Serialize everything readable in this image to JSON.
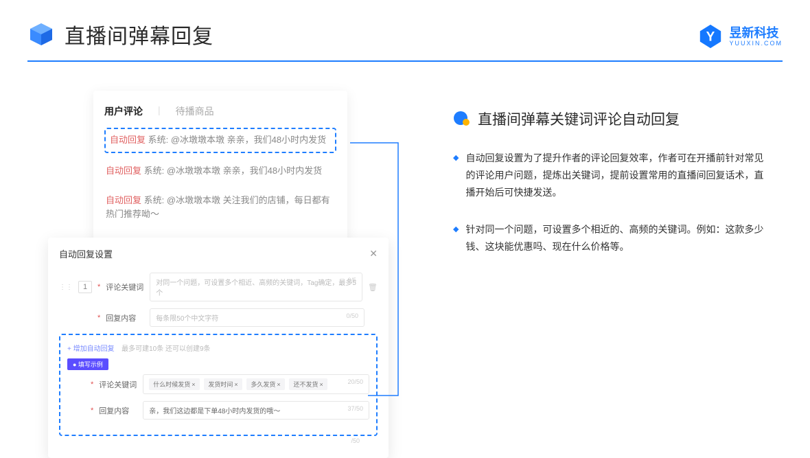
{
  "header": {
    "title": "直播间弹幕回复"
  },
  "brand": {
    "name": "昱新科技",
    "url": "YUUXIN.COM"
  },
  "comments": {
    "tab_active": "用户评论",
    "tab_inactive": "待播商品",
    "auto_tag": "自动回复",
    "row1": "系统: @冰墩墩本墩 亲亲，我们48小时内发货",
    "row2": "系统: @冰墩墩本墩 亲亲，我们48小时内发货",
    "row3": "系统: @冰墩墩本墩 关注我们的店铺，每日都有热门推荐呦～"
  },
  "settings": {
    "title": "自动回复设置",
    "order": "1",
    "label_keyword": "评论关键词",
    "placeholder_keyword": "对同一个问题，可设置多个相近、高频的关键词，Tag确定，最多5个",
    "count_keyword": "0/5",
    "label_content": "回复内容",
    "placeholder_content": "每条限50个中文字符",
    "count_content": "0/50",
    "add_link": "+ 增加自动回复",
    "add_hint": "最多可建10条 还可以创建9条",
    "example_badge": "● 填写示例",
    "ex_label_keyword": "评论关键词",
    "tags": [
      "什么时候发货",
      "发货时间",
      "多久发货",
      "还不发货"
    ],
    "ex_count_kw": "20/50",
    "ex_label_content": "回复内容",
    "ex_content_value": "亲，我们这边都是下单48小时内发货的哦～",
    "ex_count_content": "37/50",
    "outer_count": "/50"
  },
  "section": {
    "title": "直播间弹幕关键词评论自动回复",
    "bullet1": "自动回复设置为了提升作者的评论回复效率，作者可在开播前针对常见的评论用户问题，提炼出关键词，提前设置常用的直播间回复话术，直播开始后可快捷发送。",
    "bullet2": "针对同一个问题，可设置多个相近的、高频的关键词。例如：这款多少钱、这块能优惠吗、现在什么价格等。"
  }
}
